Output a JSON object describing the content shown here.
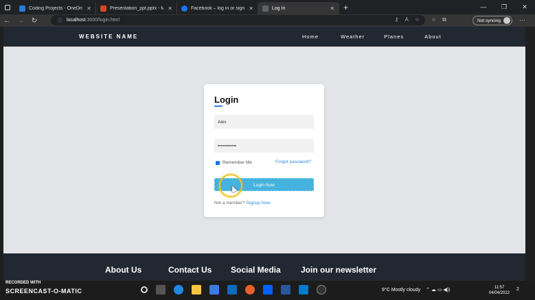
{
  "browser": {
    "tabs": [
      {
        "label": "Coding Projects - OneDrive",
        "color": "#2b7cd3",
        "active": false
      },
      {
        "label": "Presentation_ppt.pptx - Microsoft",
        "color": "#d24726",
        "active": false
      },
      {
        "label": "Facebook – log in or sign up",
        "color": "#1877f2",
        "active": false
      },
      {
        "label": "Log In",
        "color": "#5f6368",
        "active": true
      }
    ],
    "new_tab": "+",
    "url_host": "localhost",
    "url_path": ":3000/login.html",
    "sync_label": "Not syncing"
  },
  "site": {
    "brand": "WEBSITE NAME",
    "nav": [
      "Home",
      "Weather",
      "Planes",
      "About"
    ]
  },
  "login": {
    "title": "Login",
    "username_value": "Alex",
    "password_value": "••••••••••••",
    "remember_label": "Remember Me",
    "remember_checked": true,
    "forgot_label": "Forgot password?",
    "button_label": "Login Now",
    "member_text": "Not a member?",
    "signup_label": "Signup Now"
  },
  "footer": {
    "headings": [
      "About Us",
      "Contact Us",
      "Social Media",
      "Join our newsletter"
    ]
  },
  "taskbar": {
    "recorded_with": "RECORDED WITH",
    "screencast": "SCREENCAST-O-MATIC",
    "weather": "9°C  Mostly cloudy",
    "time": "11:57",
    "date": "04/04/2022",
    "notifications": "2"
  }
}
